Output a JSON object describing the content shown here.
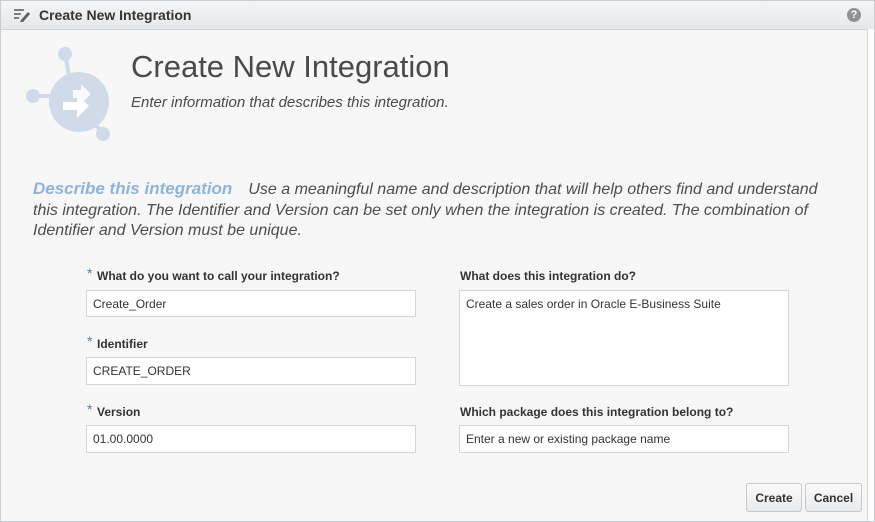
{
  "dialog": {
    "title": "Create New Integration",
    "help_icon": "?"
  },
  "header": {
    "title": "Create New Integration",
    "subtitle": "Enter information that describes this integration."
  },
  "describe": {
    "heading": "Describe this integration",
    "text": "Use a meaningful name and description that will help others find and understand this integration. The Identifier and Version can be set only when the integration is created. The combination of Identifier and Version must be unique."
  },
  "form": {
    "required_marker": "*",
    "name_label": "What do you want to call your integration?",
    "name_value": "Create_Order",
    "identifier_label": "Identifier",
    "identifier_value": "CREATE_ORDER",
    "version_label": "Version",
    "version_value": "01.00.0000",
    "description_label": "What does this integration do?",
    "description_value": "Create a sales order in Oracle E-Business Suite",
    "package_label": "Which package does this integration belong to?",
    "package_placeholder": "Enter a new or existing package name"
  },
  "buttons": {
    "create": "Create",
    "cancel": "Cancel"
  },
  "colors": {
    "accent": "#8db4e0",
    "required": "#4a7fc1",
    "icon": "#cfdbe8"
  },
  "icons": [
    "edit-icon",
    "help-icon",
    "integration-icon"
  ]
}
